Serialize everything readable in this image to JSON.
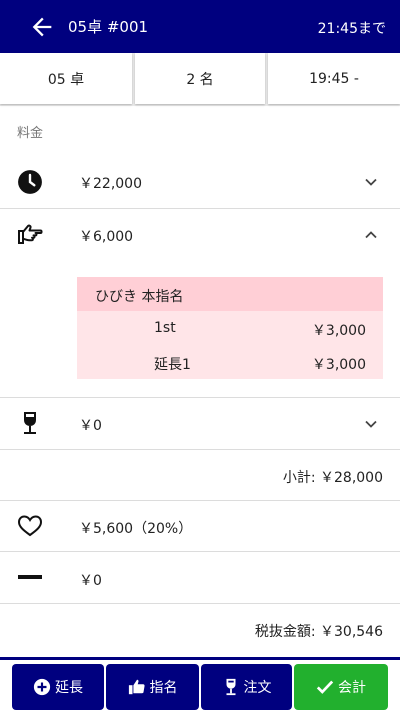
{
  "header": {
    "title": "05卓 #001",
    "until": "21:45まで"
  },
  "info": {
    "table": "05 卓",
    "guests": "2 名",
    "time": "19:45 -"
  },
  "section_label": "料金",
  "charges": {
    "time_fee": "￥22,000",
    "nomination_fee": "￥6,000",
    "drink_fee": "￥0",
    "service_fee": "￥5,600（20%）",
    "discount": "￥0"
  },
  "nomination": {
    "header": "ひびき 本指名",
    "lines": [
      {
        "label": "1st",
        "value": "￥3,000"
      },
      {
        "label": "延長1",
        "value": "￥3,000"
      }
    ]
  },
  "subtotal": "小計: ￥28,000",
  "pretax_total": "税抜金額: ￥30,546",
  "footer": {
    "extend": "延長",
    "nominate": "指名",
    "order": "注文",
    "checkout": "会計"
  },
  "colors": {
    "navy": "#00007f",
    "green": "#22b02e",
    "pink_head": "#ffcfd6",
    "pink_row": "#ffe5e8"
  }
}
